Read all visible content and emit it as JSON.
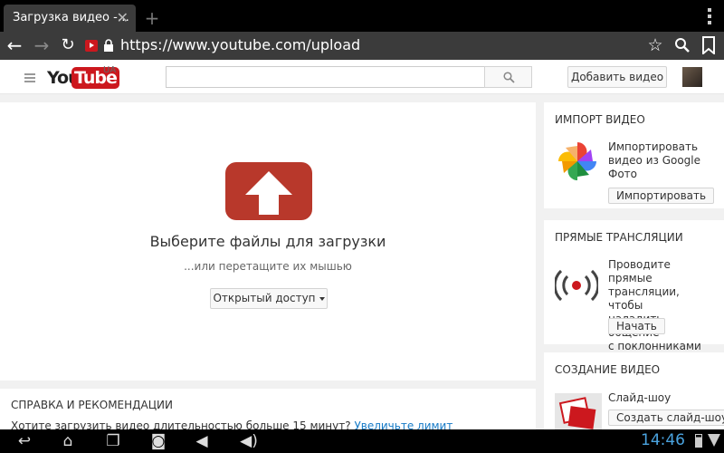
{
  "browser": {
    "tab_title": "Загрузка видео -…",
    "tab_close": "✕",
    "new_tab": "+",
    "url": "https://www.youtube.com/upload"
  },
  "youtube": {
    "logo_you": "You",
    "logo_tube": "Tube",
    "region": "UA",
    "upload_button": "Добавить видео"
  },
  "upload": {
    "title": "Выберите файлы для загрузки",
    "subtitle": "...или перетащите их мышью",
    "privacy_select": "Открытый доступ"
  },
  "help": {
    "title": "СПРАВКА И РЕКОМЕНДАЦИИ",
    "text": "Хотите загрузить видео длительностью больше 15 минут?",
    "link": "Увеличьте лимит"
  },
  "sidebar": {
    "import": {
      "title": "ИМПОРТ ВИДЕО",
      "line1": "Импортировать",
      "line2": "видео из Google",
      "line3": "Фото",
      "button": "Импортировать"
    },
    "live": {
      "title": "ПРЯМЫЕ ТРАНСЛЯЦИИ",
      "line1": "Проводите прямые",
      "line2": "трансляции, чтобы",
      "line3": "наладить общение",
      "line4": "с поклонниками",
      "button": "Начать"
    },
    "create": {
      "title": "СОЗДАНИЕ ВИДЕО",
      "label": "Слайд-шоу",
      "button": "Создать слайд-шоу"
    }
  },
  "system": {
    "clock": "14:46"
  },
  "colors": {
    "brand_red": "#cc181e",
    "upload_icon_red": "#b8382b",
    "link_blue": "#167ac6",
    "clock_blue": "#4aa3df"
  }
}
